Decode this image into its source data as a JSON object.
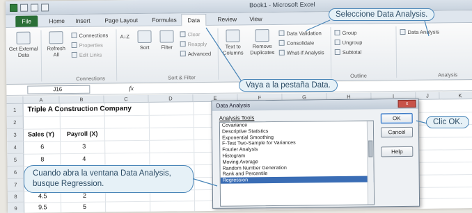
{
  "window": {
    "title": "Book1 - Microsoft Excel"
  },
  "tabs": [
    "File",
    "Home",
    "Insert",
    "Page Layout",
    "Formulas",
    "Data",
    "Review",
    "View"
  ],
  "ribbon": {
    "get_external_data": "Get External Data",
    "refresh_all": "Refresh All",
    "connections": "Connections",
    "properties": "Properties",
    "edit_links": "Edit Links",
    "connections_group": "Connections",
    "sort_az": "A↓Z",
    "sort": "Sort",
    "filter": "Filter",
    "clear": "Clear",
    "reapply": "Reapply",
    "advanced": "Advanced",
    "sort_filter_group": "Sort & Filter",
    "text_to_columns": "Text to Columns",
    "remove_duplicates": "Remove Duplicates",
    "data_validation": "Data Validation",
    "consolidate": "Consolidate",
    "what_if": "What-If Analysis",
    "group": "Group",
    "ungroup": "Ungroup",
    "subtotal": "Subtotal",
    "outline_group": "Outline",
    "data_analysis": "Data Analysis",
    "analysis_group": "Analysis"
  },
  "formula_bar": {
    "name_box": "J16",
    "fx": "fx"
  },
  "columns": [
    "A",
    "B",
    "C",
    "D",
    "E",
    "F",
    "G",
    "H",
    "I",
    "J",
    "K"
  ],
  "rows": [
    "1",
    "2",
    "3",
    "4",
    "5",
    "6",
    "7",
    "8",
    "9"
  ],
  "sheet": {
    "title": "Triple A Construction Company",
    "header_a": "Sales (Y)",
    "header_b": "Payroll (X)",
    "row3_a": "6",
    "row3_b": "3",
    "row4_a": "8",
    "row4_b": "4",
    "row7_a": "4.5",
    "row7_b": "2",
    "row8_a": "9.5",
    "row8_b": "5"
  },
  "dialog": {
    "title": "Data Analysis",
    "close": "x",
    "list_label": "Analysis Tools",
    "items": [
      "Covariance",
      "Descriptive Statistics",
      "Exponential Smoothing",
      "F-Test Two-Sample for Variances",
      "Fourier Analysis",
      "Histogram",
      "Moving Average",
      "Random Number Generation",
      "Rank and Percentile",
      "Regression"
    ],
    "selected_index": 9,
    "ok": "OK",
    "cancel": "Cancel",
    "help": "Help"
  },
  "callouts": {
    "data_analysis": "Seleccione Data Analysis.",
    "data_tab": "Vaya a la pestaña Data.",
    "ok": "Clic OK.",
    "regression": "Cuando abra la ventana Data Analysis, busque Regression."
  },
  "colors": {
    "callout_border": "#4a86b8",
    "callout_fill": "#e6f1f7",
    "file_tab": "#2a6f37",
    "selection": "#3a6db5"
  }
}
